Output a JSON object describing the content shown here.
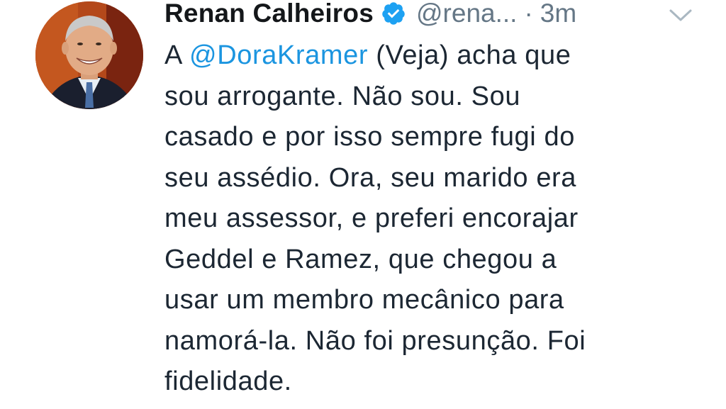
{
  "tweet": {
    "author_name": "Renan Calheiros",
    "handle": "@rena...",
    "separator": "·",
    "timestamp": "3m",
    "verified": true,
    "avatar_icon": "profile-photo",
    "menu_icon": "chevron-down-icon",
    "colors": {
      "mention": "#1b95e0",
      "verified_badge": "#1da1f2",
      "muted": "#657786"
    },
    "body": {
      "line1_prefix": "A ",
      "line1_mention": "@DoraKramer",
      "line1_suffix": " (Veja) acha que",
      "lines": [
        "sou arrogante. Não sou. Sou",
        "casado e por isso sempre fugi do",
        "seu assédio. Ora, seu marido era",
        "meu assessor, e preferi encorajar",
        "Geddel e Ramez, que chegou a",
        "usar um membro mecânico para",
        "namorá-la. Não foi presunção. Foi",
        "fidelidade."
      ]
    }
  }
}
